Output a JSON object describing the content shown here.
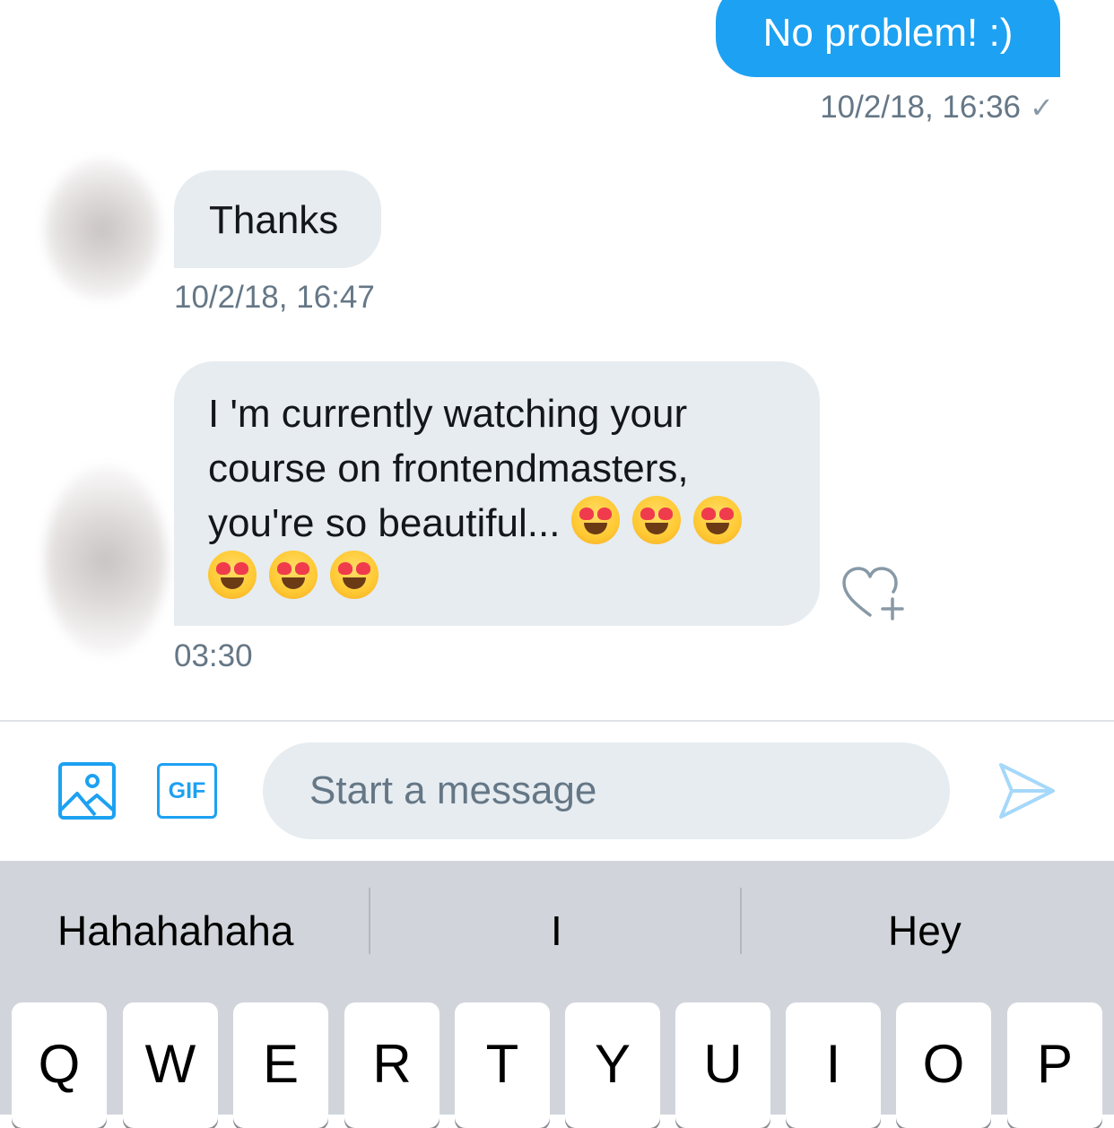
{
  "messages": [
    {
      "text": "No problem! :)",
      "time": "10/2/18, 16:36",
      "status": "✓"
    },
    {
      "text": "Thanks",
      "time": "10/2/18, 16:47"
    },
    {
      "text": "I 'm currently watching your course on frontendmasters, you're so beautiful...",
      "emoji_count": 6,
      "time": "03:30"
    }
  ],
  "composer": {
    "placeholder": "Start a message",
    "gif_label": "GIF"
  },
  "keyboard": {
    "suggestions": [
      "Hahahahaha",
      "I",
      "Hey"
    ],
    "keys": [
      "Q",
      "W",
      "E",
      "R",
      "T",
      "Y",
      "U",
      "I",
      "O",
      "P"
    ]
  },
  "colors": {
    "accent": "#1da1f2",
    "bubble_in": "#e6ecf0",
    "timestamp": "#657786"
  },
  "icons": [
    "media-icon",
    "heart-plus-icon",
    "send-icon"
  ]
}
